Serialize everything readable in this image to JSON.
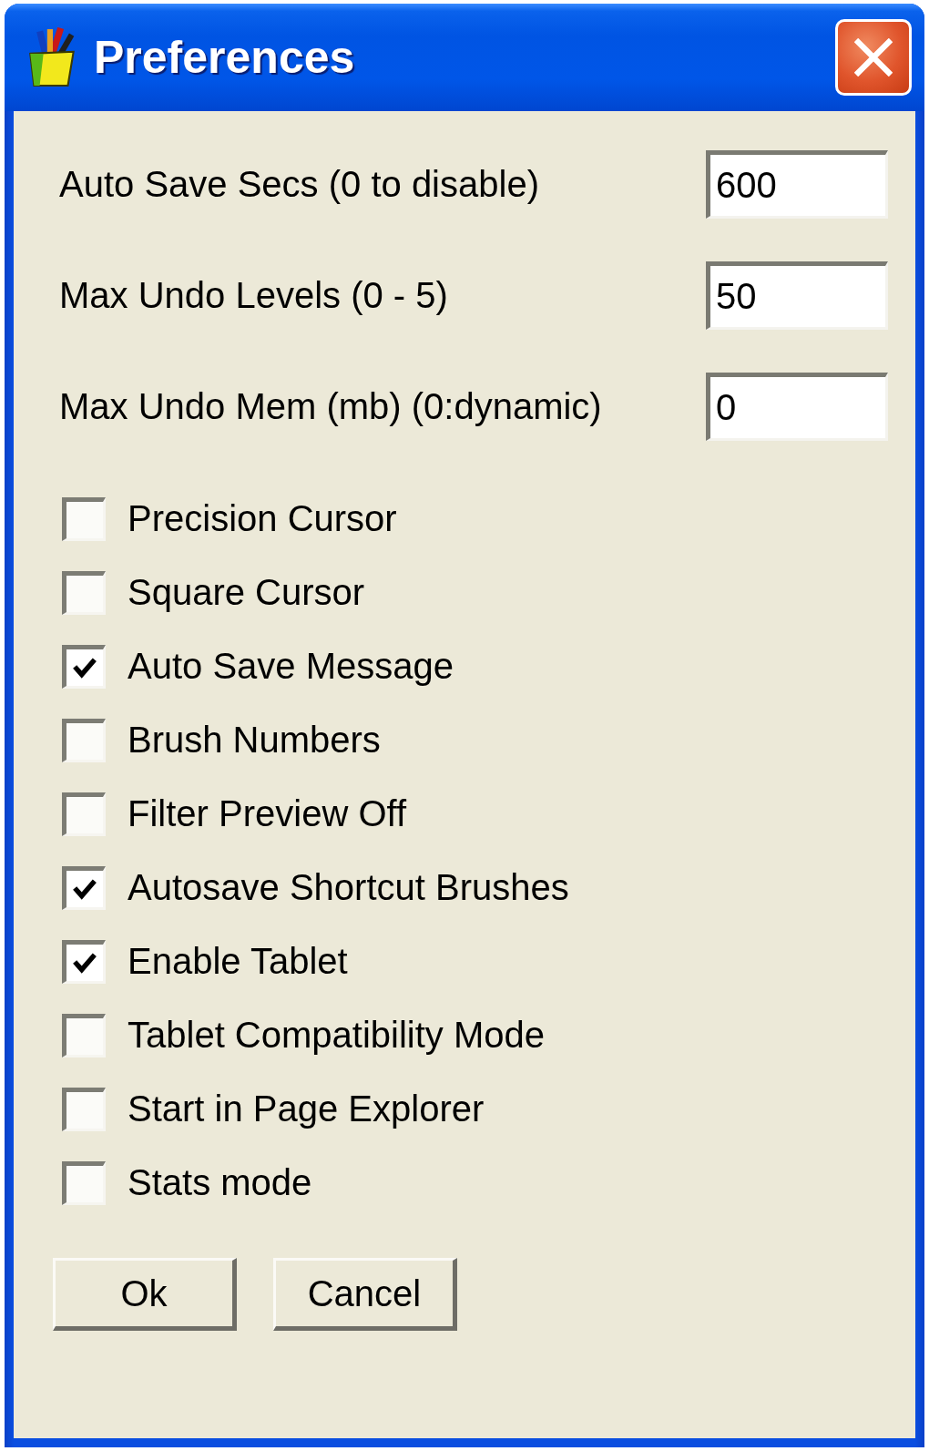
{
  "window": {
    "title": "Preferences"
  },
  "fields": [
    {
      "label": "Auto Save Secs (0 to disable)",
      "value": "600"
    },
    {
      "label": "Max Undo Levels (0 - 5)",
      "value": "50"
    },
    {
      "label": "Max Undo Mem (mb) (0:dynamic)",
      "value": "0"
    }
  ],
  "options": [
    {
      "label": "Precision Cursor",
      "checked": false
    },
    {
      "label": "Square Cursor",
      "checked": false
    },
    {
      "label": "Auto Save Message",
      "checked": true
    },
    {
      "label": "Brush Numbers",
      "checked": false
    },
    {
      "label": "Filter Preview Off",
      "checked": false
    },
    {
      "label": "Autosave Shortcut Brushes",
      "checked": true
    },
    {
      "label": "Enable Tablet",
      "checked": true
    },
    {
      "label": "Tablet Compatibility Mode",
      "checked": false
    },
    {
      "label": "Start in Page Explorer",
      "checked": false
    },
    {
      "label": "Stats mode",
      "checked": false
    }
  ],
  "buttons": [
    "Ok",
    "Cancel"
  ]
}
